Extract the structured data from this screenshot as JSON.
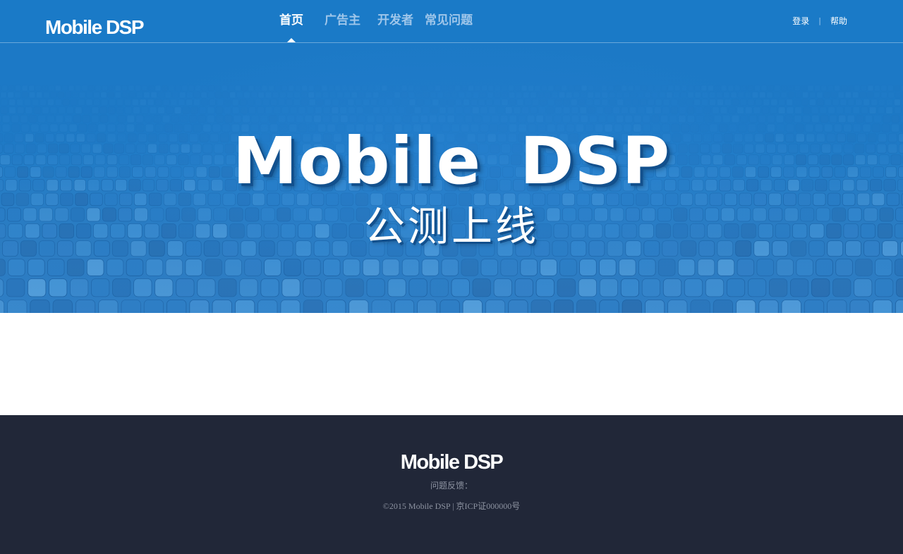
{
  "header": {
    "logo": "Mobile DSP",
    "nav": [
      {
        "label": "首页",
        "active": true
      },
      {
        "label": "广告主",
        "active": false
      },
      {
        "label": "开发者",
        "active": false
      },
      {
        "label": "常见问题",
        "active": false
      }
    ],
    "login_label": "登录",
    "separator": "|",
    "help_label": "帮助"
  },
  "banner": {
    "title": "Mobile DSP",
    "subtitle": "公测上线"
  },
  "footer": {
    "logo": "Mobile DSP",
    "feedback": "问题反馈：",
    "copyright": "©2015 Mobile DSP | 京ICP证000000号"
  },
  "colors": {
    "header_bg": "#1a7ac7",
    "nav_inactive": "#9fc6ea",
    "footer_bg": "#212738",
    "footer_text": "#8d93a1"
  }
}
